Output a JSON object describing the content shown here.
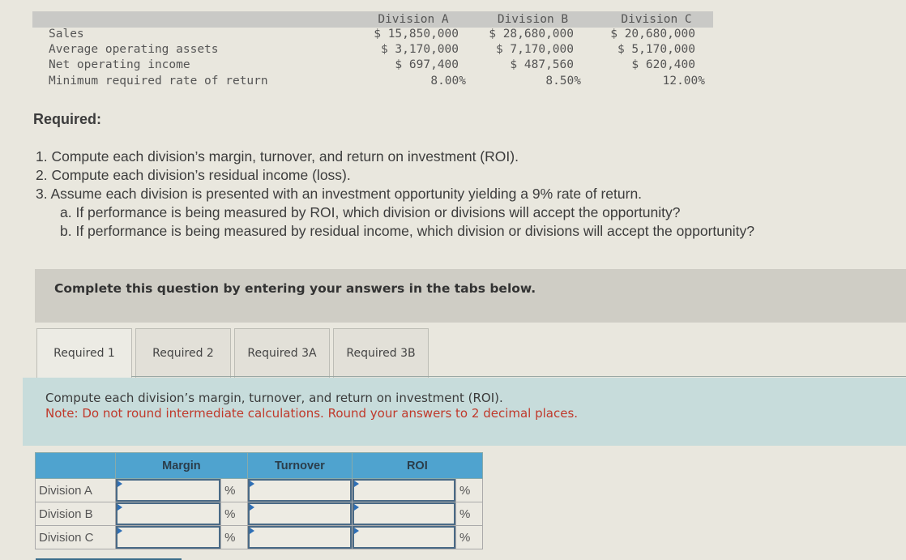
{
  "data_table": {
    "headers": [
      "Division A",
      "Division B",
      "Division C"
    ],
    "rows": [
      {
        "label": "Sales",
        "values": [
          "$ 15,850,000",
          "$ 28,680,000",
          "$ 20,680,000"
        ]
      },
      {
        "label": "Average operating assets",
        "values": [
          "$ 3,170,000",
          "$ 7,170,000",
          "$ 5,170,000"
        ]
      },
      {
        "label": "Net operating income",
        "values": [
          "$ 697,400",
          "$ 487,560",
          "$ 620,400"
        ]
      },
      {
        "label": "Minimum required rate of return",
        "values": [
          "8.00%",
          "8.50%",
          "12.00%"
        ]
      }
    ]
  },
  "required": {
    "title": "Required:",
    "items": [
      "1. Compute each division’s margin, turnover, and return on investment (ROI).",
      "2. Compute each division’s residual income (loss).",
      "3. Assume each division is presented with an investment opportunity yielding a 9% rate of return."
    ],
    "subitems": [
      "a. If performance is being measured by ROI, which division or divisions will accept the opportunity?",
      "b. If performance is being measured by residual income, which division or divisions will accept the opportunity?"
    ]
  },
  "instruction": "Complete this question by entering your answers in the tabs below.",
  "tabs": [
    {
      "label": "Required 1",
      "active": true
    },
    {
      "label": "Required 2",
      "active": false
    },
    {
      "label": "Required 3A",
      "active": false
    },
    {
      "label": "Required 3B",
      "active": false
    }
  ],
  "content": {
    "prompt": "Compute each division’s margin, turnover, and return on investment (ROI).",
    "note": "Note: Do not round intermediate calculations. Round your answers to 2 decimal places."
  },
  "answer_table": {
    "columns": [
      "Margin",
      "Turnover",
      "ROI"
    ],
    "unit_symbol": "%",
    "rows": [
      {
        "label": "Division A",
        "margin": "",
        "turnover": "",
        "roi": ""
      },
      {
        "label": "Division B",
        "margin": "",
        "turnover": "",
        "roi": ""
      },
      {
        "label": "Division C",
        "margin": "",
        "turnover": "",
        "roi": ""
      }
    ]
  },
  "colors": {
    "header_blue": "#4fa3cf",
    "note_red": "#c0392b",
    "content_band": "#c7dcdb"
  }
}
